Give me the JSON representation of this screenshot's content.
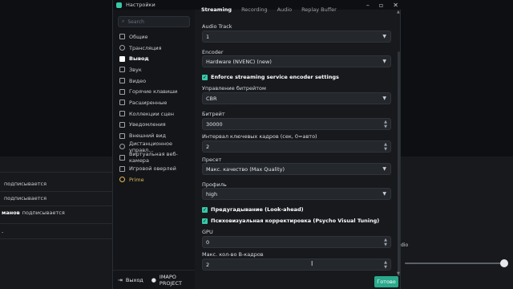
{
  "window": {
    "title": "Настройки"
  },
  "background": {
    "rows": [
      {
        "name": "",
        "text": "подписывается"
      },
      {
        "name": "",
        "text": "подписывается"
      },
      {
        "name": "манов",
        "text": "подписывается"
      }
    ],
    "dash": "-",
    "audio_label": "dio"
  },
  "sidebar": {
    "search_placeholder": "Search",
    "items": [
      {
        "label": "Общие"
      },
      {
        "label": "Трансляция"
      },
      {
        "label": "Вывод"
      },
      {
        "label": "Звук"
      },
      {
        "label": "Видео"
      },
      {
        "label": "Горячие клавиши"
      },
      {
        "label": "Расширенные"
      },
      {
        "label": "Коллекции сцен"
      },
      {
        "label": "Уведомления"
      },
      {
        "label": "Внешний вид"
      },
      {
        "label": "Дистанционное управл..."
      },
      {
        "label": "Виртуальная веб-камера"
      },
      {
        "label": "Игровой оверлей"
      },
      {
        "label": "Prime"
      }
    ],
    "footer": {
      "exit": "Выход",
      "user": "IMAPO PROJECT"
    }
  },
  "tabs": [
    "Streaming",
    "Recording",
    "Audio",
    "Replay Buffer"
  ],
  "fields": {
    "audio_track": {
      "label": "Audio Track",
      "value": "1"
    },
    "encoder": {
      "label": "Encoder",
      "value": "Hardware (NVENC) (new)"
    },
    "enforce": {
      "label": "Enforce streaming service encoder settings",
      "checked": true
    },
    "rate_control": {
      "label": "Управление битрейтом",
      "value": "CBR"
    },
    "bitrate": {
      "label": "Битрейт",
      "value": "30000"
    },
    "keyframe": {
      "label": "Интервал ключевых кадров (сек, 0=авто)",
      "value": "2"
    },
    "preset": {
      "label": "Пресет",
      "value": "Макс. качество (Max Quality)"
    },
    "profile": {
      "label": "Профиль",
      "value": "high"
    },
    "lookahead": {
      "label": "Предугадывание (Look-ahead)",
      "checked": true
    },
    "psycho": {
      "label": "Психовизуальная корректировка (Psycho Visual Tuning)",
      "checked": true
    },
    "gpu": {
      "label": "GPU",
      "value": "0"
    },
    "bframes": {
      "label": "Макс. кол-во B-кадров",
      "value": "2"
    }
  },
  "done_button": "Готово",
  "colors": {
    "accent": "#38c8a8",
    "prime": "#e2b85a",
    "bg": "#17191d"
  }
}
